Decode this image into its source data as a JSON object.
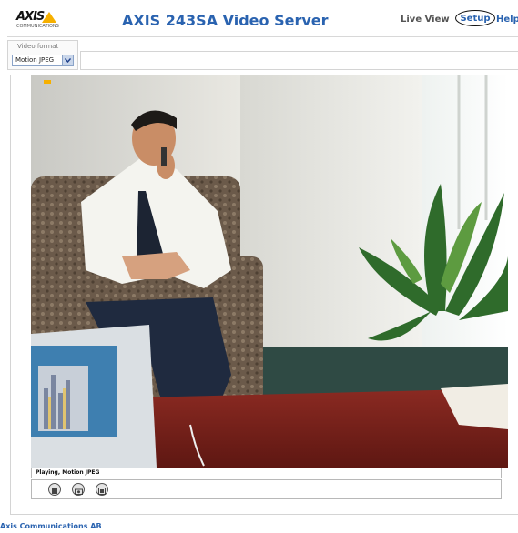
{
  "header": {
    "logo_text": "AXIS",
    "logo_subtext": "COMMUNICATIONS",
    "title": "AXIS 243SA Video Server",
    "nav": {
      "live_view": "Live View",
      "setup": "Setup",
      "help": "Help"
    }
  },
  "format": {
    "label": "Video format",
    "selected": "Motion JPEG"
  },
  "video": {
    "status": "Playing, Motion JPEG"
  },
  "controls": {
    "buttons": [
      "stop-icon",
      "snapshot-icon",
      "view-full-screen-icon"
    ]
  },
  "footer": {
    "company": "Axis Communications AB"
  },
  "colors": {
    "title_blue": "#2a63b0",
    "logo_yellow": "#f6b000",
    "border_gray": "#d4d4d4"
  }
}
